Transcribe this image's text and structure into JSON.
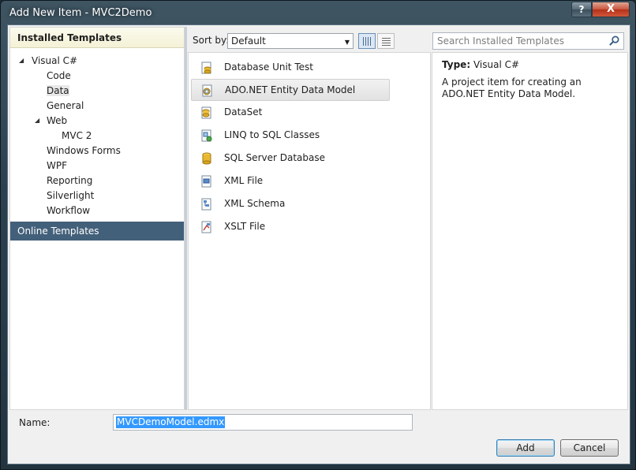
{
  "window": {
    "title": "Add New Item - MVC2Demo",
    "help_label": "?",
    "close_label": "X"
  },
  "left": {
    "header": "Installed Templates",
    "tree": [
      {
        "label": "Visual C#",
        "expanded": true
      },
      {
        "label": "Code"
      },
      {
        "label": "Data",
        "selected": true
      },
      {
        "label": "General"
      },
      {
        "label": "Web",
        "expanded": true
      },
      {
        "label": "MVC 2"
      },
      {
        "label": "Windows Forms"
      },
      {
        "label": "WPF"
      },
      {
        "label": "Reporting"
      },
      {
        "label": "Silverlight"
      },
      {
        "label": "Workflow"
      }
    ],
    "online": "Online Templates"
  },
  "toolbar": {
    "sort_label": "Sort by:",
    "sort_value": "Default",
    "search_placeholder": "Search Installed Templates"
  },
  "templates": [
    {
      "label": "Database Unit Test",
      "icon": "database-unit-test-icon"
    },
    {
      "label": "ADO.NET Entity Data Model",
      "icon": "entity-model-icon",
      "selected": true
    },
    {
      "label": "DataSet",
      "icon": "dataset-icon"
    },
    {
      "label": "LINQ to SQL Classes",
      "icon": "linq-icon"
    },
    {
      "label": "SQL Server Database",
      "icon": "sql-database-icon"
    },
    {
      "label": "XML File",
      "icon": "xml-file-icon"
    },
    {
      "label": "XML Schema",
      "icon": "xml-schema-icon"
    },
    {
      "label": "XSLT File",
      "icon": "xslt-file-icon"
    }
  ],
  "info": {
    "type_label": "Type:",
    "type_value": "Visual C#",
    "description": "A project item for creating an ADO.NET Entity Data Model."
  },
  "bottom": {
    "name_label": "Name:",
    "name_value": "MVCDemoModel.edmx",
    "add_label": "Add",
    "cancel_label": "Cancel"
  },
  "colors": {
    "online_bg": "#43607a",
    "selection": "#3399ff",
    "close_button": "#c9563e"
  }
}
